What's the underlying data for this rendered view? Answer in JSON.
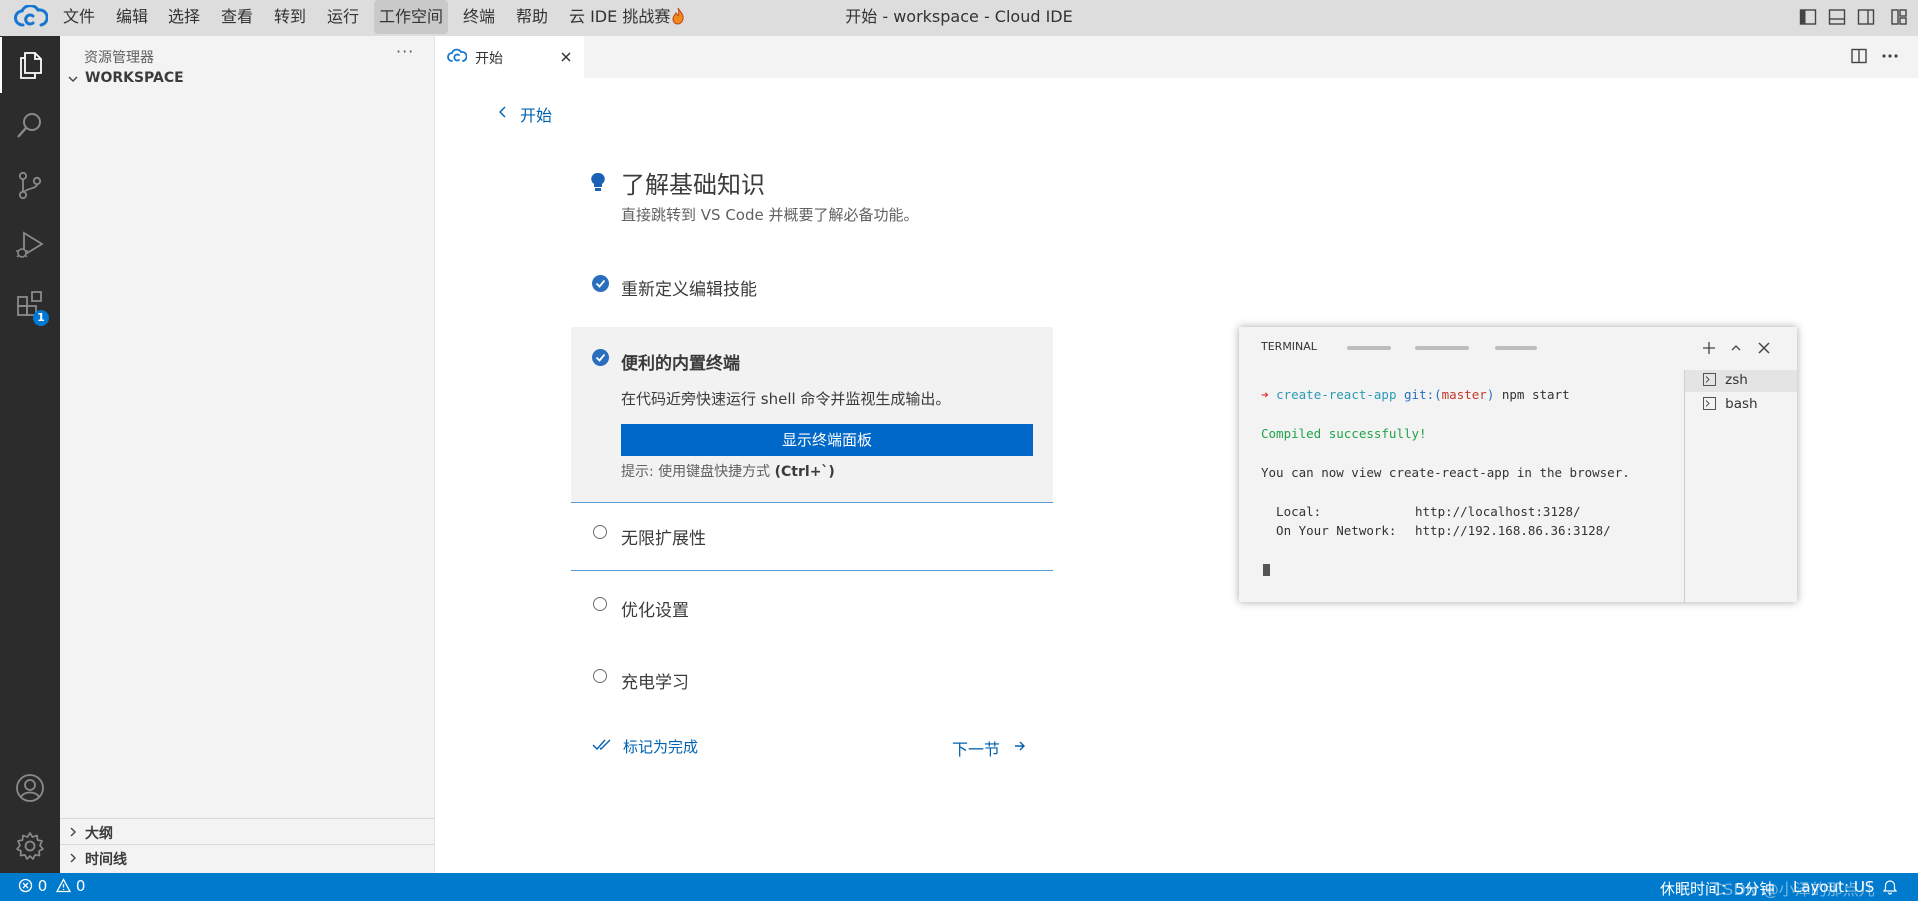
{
  "menu": [
    "文件",
    "编辑",
    "选择",
    "查看",
    "转到",
    "运行",
    "工作空间",
    "终端",
    "帮助",
    "云 IDE 挑战赛"
  ],
  "window_title": "开始 - workspace - Cloud IDE",
  "activity": {
    "extensions_badge": "1"
  },
  "sidebar": {
    "title": "资源管理器",
    "more": "···",
    "workspace": "WORKSPACE",
    "outline": "大纲",
    "timeline": "时间线"
  },
  "tab": {
    "label": "开始"
  },
  "walkthrough": {
    "back": "开始",
    "title": "了解基础知识",
    "subtitle": "直接跳转到 VS Code 并概要了解必备功能。",
    "steps": [
      {
        "label": "重新定义编辑技能",
        "done": true
      },
      {
        "label": "便利的内置终端",
        "done": true,
        "expanded": true,
        "description": "在代码近旁快速运行 shell 命令并监视生成输出。",
        "button": "显示终端面板",
        "hint_prefix": "提示: 使用键盘快捷方式 ",
        "hint_key": "(Ctrl+`)"
      },
      {
        "label": "无限扩展性",
        "done": false
      },
      {
        "label": "优化设置",
        "done": false
      },
      {
        "label": "充电学习",
        "done": false
      }
    ],
    "mark_done": "标记为完成",
    "next": "下一节"
  },
  "terminal": {
    "tab": "TERMINAL",
    "arrow": "➜",
    "dir": "create-react-app",
    "git_pre": "git:(",
    "branch": "master",
    "git_post": ")",
    "cmd": "npm start",
    "compiled": "Compiled successfully!",
    "view_line": "You can now view create-react-app in the browser.",
    "local_label": "  Local:",
    "local_url": "http://localhost:3128/",
    "network_label": "  On Your Network:",
    "network_url": "http://192.168.86.36:3128/",
    "shells": [
      "zsh",
      "bash"
    ]
  },
  "status": {
    "errors": "0",
    "warnings": "0",
    "sleep": "休眠时间：5分钟",
    "layout": "Layout: US",
    "watermark": "CSDN @小泽的那点儿"
  },
  "colors": {
    "accent": "#007acc",
    "button": "#0068c8",
    "link": "#0062b1",
    "check": "#2a6ebd",
    "activity_bar": "#2c2c2c"
  }
}
